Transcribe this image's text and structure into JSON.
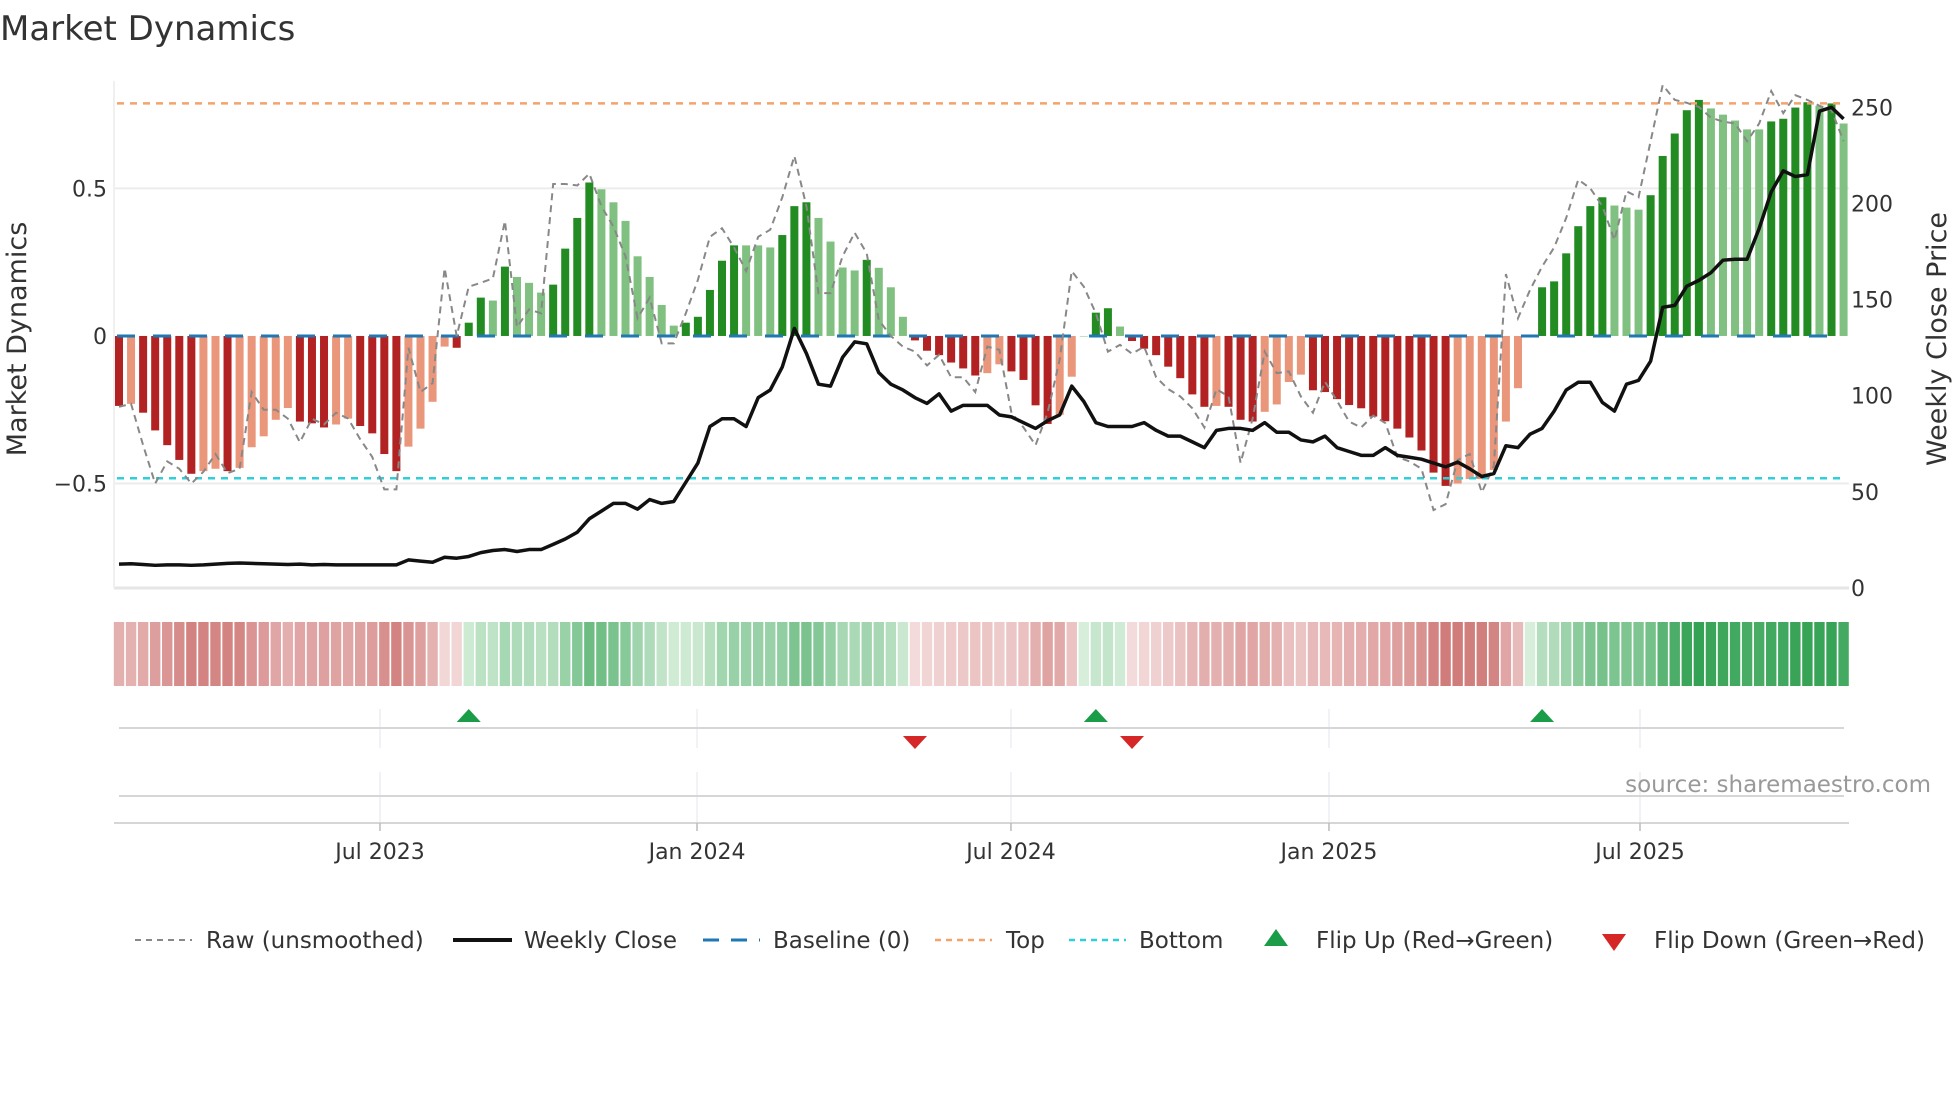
{
  "chart_data": {
    "type": "bar",
    "title": "Market Dynamics",
    "ylabel_left": "Market Dynamics",
    "ylabel_right": "Weekly Close Price",
    "ylim_left": [
      -0.854,
      0.864
    ],
    "ylim_right": [
      0,
      263.7
    ],
    "left_ticks": [
      {
        "v": 0.5,
        "label": "0.5"
      },
      {
        "v": 0,
        "label": "0"
      },
      {
        "v": -0.5,
        "label": "−0.5"
      }
    ],
    "right_ticks": [
      {
        "v": 250,
        "label": "250"
      },
      {
        "v": 200,
        "label": "200"
      },
      {
        "v": 150,
        "label": "150"
      },
      {
        "v": 100,
        "label": "100"
      },
      {
        "v": 50,
        "label": "50"
      },
      {
        "v": 0,
        "label": "0"
      }
    ],
    "x_ticks": [
      {
        "week": 21.64,
        "label": "Jul 2023"
      },
      {
        "week": 47.93,
        "label": "Jan 2024"
      },
      {
        "week": 73.96,
        "label": "Jul 2024"
      },
      {
        "week": 100.33,
        "label": "Jan 2025"
      },
      {
        "week": 126.12,
        "label": "Jul 2025"
      }
    ],
    "top_level": 0.788,
    "bottom_level": -0.482,
    "baseline": 0,
    "values": [
      -0.237,
      -0.23,
      -0.26,
      -0.32,
      -0.37,
      -0.42,
      -0.467,
      -0.458,
      -0.45,
      -0.458,
      -0.447,
      -0.377,
      -0.34,
      -0.284,
      -0.244,
      -0.29,
      -0.296,
      -0.31,
      -0.3,
      -0.28,
      -0.305,
      -0.33,
      -0.4,
      -0.458,
      -0.375,
      -0.314,
      -0.223,
      -0.036,
      -0.04,
      0.045,
      0.13,
      0.12,
      0.235,
      0.2,
      0.18,
      0.147,
      0.174,
      0.296,
      0.4,
      0.52,
      0.497,
      0.453,
      0.39,
      0.27,
      0.2,
      0.105,
      0.035,
      0.045,
      0.065,
      0.156,
      0.255,
      0.307,
      0.307,
      0.307,
      0.3,
      0.342,
      0.44,
      0.453,
      0.4,
      0.32,
      0.232,
      0.222,
      0.258,
      0.231,
      0.165,
      0.065,
      -0.015,
      -0.05,
      -0.065,
      -0.09,
      -0.11,
      -0.134,
      -0.126,
      -0.096,
      -0.12,
      -0.149,
      -0.235,
      -0.298,
      -0.267,
      -0.138,
      0.0,
      0.079,
      0.094,
      0.032,
      -0.017,
      -0.043,
      -0.065,
      -0.104,
      -0.143,
      -0.198,
      -0.24,
      -0.237,
      -0.24,
      -0.284,
      -0.29,
      -0.257,
      -0.232,
      -0.156,
      -0.131,
      -0.184,
      -0.19,
      -0.214,
      -0.234,
      -0.245,
      -0.273,
      -0.289,
      -0.314,
      -0.344,
      -0.388,
      -0.463,
      -0.508,
      -0.5,
      -0.485,
      -0.485,
      -0.454,
      -0.29,
      -0.177,
      0.0,
      0.165,
      0.185,
      0.28,
      0.372,
      0.44,
      0.47,
      0.442,
      0.435,
      0.428,
      0.477,
      0.61,
      0.686,
      0.765,
      0.8,
      0.771,
      0.75,
      0.73,
      0.7,
      0.7,
      0.727,
      0.736,
      0.774,
      0.792,
      0.78,
      0.788,
      0.72
    ],
    "shade": "DLDDDDDLLDLLLLLDDDLLDDDDLLLLDDDLDLLLDDDDLLLLLLLDDDDDLLLDDDLLLLDLLLDDDDDDLLDDDDLLLDDLDDDDDDDLDDDLLLLDDDDDDDDDDDDLLLLLLLDDDDDDLLLDDDDDLLLLLDDDDLDL",
    "raw": [
      -0.24,
      -0.23,
      -0.37,
      -0.5,
      -0.425,
      -0.45,
      -0.5,
      -0.46,
      -0.4,
      -0.465,
      -0.45,
      -0.19,
      -0.25,
      -0.25,
      -0.28,
      -0.36,
      -0.28,
      -0.3,
      -0.26,
      -0.28,
      -0.35,
      -0.41,
      -0.52,
      -0.52,
      -0.04,
      -0.19,
      -0.16,
      0.23,
      0.0,
      0.167,
      0.18,
      0.195,
      0.39,
      0.03,
      0.09,
      0.077,
      0.515,
      0.515,
      0.51,
      0.55,
      0.44,
      0.37,
      0.27,
      0.06,
      0.13,
      -0.025,
      -0.025,
      0.077,
      0.19,
      0.336,
      0.365,
      0.3,
      0.22,
      0.336,
      0.36,
      0.47,
      0.61,
      0.44,
      0.145,
      0.145,
      0.27,
      0.35,
      0.28,
      0.054,
      0.0,
      -0.036,
      -0.053,
      -0.1,
      -0.064,
      -0.14,
      -0.14,
      -0.19,
      -0.036,
      -0.047,
      -0.26,
      -0.31,
      -0.37,
      -0.26,
      -0.08,
      0.22,
      0.167,
      0.077,
      -0.053,
      -0.03,
      -0.06,
      -0.036,
      -0.14,
      -0.18,
      -0.205,
      -0.245,
      -0.31,
      -0.18,
      -0.205,
      -0.43,
      -0.28,
      -0.053,
      -0.126,
      -0.12,
      -0.205,
      -0.26,
      -0.155,
      -0.22,
      -0.29,
      -0.31,
      -0.27,
      -0.295,
      -0.41,
      -0.425,
      -0.45,
      -0.59,
      -0.57,
      -0.42,
      -0.4,
      -0.53,
      -0.44,
      0.21,
      0.06,
      0.156,
      0.235,
      0.3,
      0.4,
      0.53,
      0.5,
      0.44,
      0.325,
      0.49,
      0.47,
      0.66,
      0.85,
      0.8,
      0.79,
      0.776,
      0.74,
      0.726,
      0.72,
      0.66,
      0.72,
      0.83,
      0.755,
      0.816,
      0.8,
      0.78,
      0.765,
      0.66
    ],
    "weekly_close": [
      12.4,
      12.6,
      12.2,
      11.8,
      12,
      12,
      11.8,
      12,
      12.4,
      12.8,
      13,
      12.8,
      12.6,
      12.4,
      12.2,
      12.4,
      12,
      12.2,
      12,
      12,
      12,
      12,
      12,
      12,
      14.6,
      14,
      13.4,
      16,
      15.5,
      16.4,
      18.4,
      19.5,
      20,
      19,
      20,
      20,
      22.7,
      25.5,
      29,
      36,
      40,
      44,
      44,
      41,
      46,
      44,
      45,
      55,
      65,
      84,
      88,
      88,
      84,
      99,
      103,
      115,
      135,
      122,
      106,
      105,
      120,
      128,
      127,
      112,
      106,
      103,
      99,
      96,
      101,
      92,
      95,
      95,
      95,
      90,
      89,
      86,
      83,
      87,
      90,
      105,
      97,
      86,
      84,
      84,
      84,
      86,
      82,
      79,
      79,
      76,
      73,
      82,
      83,
      83,
      82,
      86,
      81,
      81,
      77,
      76,
      79,
      73,
      71,
      69,
      69,
      73,
      69,
      68,
      67,
      65,
      63,
      65.5,
      62,
      58,
      59.5,
      74,
      73,
      80,
      83,
      92,
      103,
      107,
      107,
      96.5,
      92,
      106,
      108,
      118,
      146,
      147,
      157,
      160,
      164,
      170.5,
      171,
      171,
      187,
      206,
      217,
      214,
      215,
      248,
      250,
      244
    ],
    "flips_up": [
      29,
      81,
      118
    ],
    "flips_down": [
      66,
      84
    ],
    "legend": {
      "raw": "Raw (unsmoothed)",
      "close": "Weekly Close",
      "baseline": "Baseline (0)",
      "top": "Top",
      "bottom": "Bottom",
      "flip_up": "Flip Up (Red→Green)",
      "flip_down": "Flip Down (Green→Red)"
    },
    "legend_position": "bottom",
    "source": "source: sharemaestro.com",
    "colors": {
      "red_strong": "#b22222",
      "red_weak": "#e9967a",
      "green_strong": "#228b22",
      "green_weak": "#80c080",
      "baseline": "#1f77b4",
      "top": "#f4a36c",
      "bottom": "#2ecfd8",
      "raw": "#888888",
      "close": "#111111",
      "flip_up": "#1a9c48",
      "flip_down": "#d62728"
    }
  }
}
